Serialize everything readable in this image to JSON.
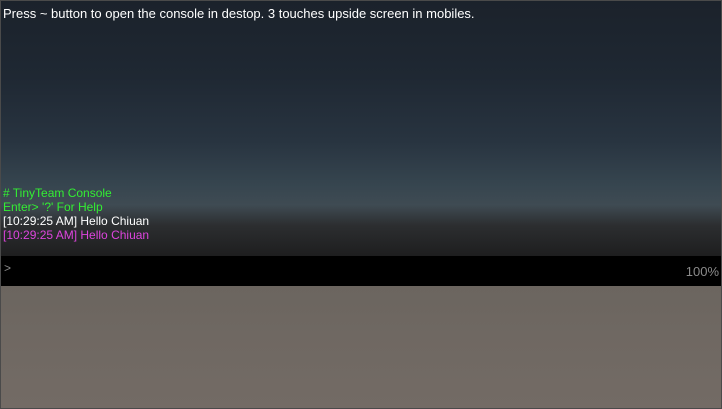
{
  "hint": {
    "text": "Press ~ button to open the console in destop. 3 touches upside screen in mobiles."
  },
  "console": {
    "lines": [
      {
        "text": "# TinyTeam Console",
        "color": "#33ee33"
      },
      {
        "text": "Enter> '?' For Help",
        "color": "#33ee33"
      },
      {
        "text": "[10:29:25 AM] Hello Chiuan",
        "color": "#ffffff"
      },
      {
        "text": "[10:29:25 AM] Hello Chiuan",
        "color": "#dd44dd"
      }
    ],
    "prompt_symbol": ">",
    "input_value": "",
    "input_placeholder": "",
    "zoom": "100%"
  }
}
